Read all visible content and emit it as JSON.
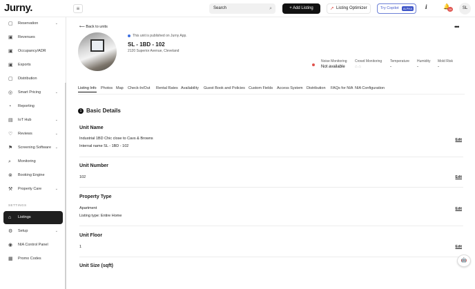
{
  "header": {
    "logo": "Jurny.",
    "collapse_icon": "≡",
    "search_placeholder": "Search",
    "add_listing": "+ Add Listing",
    "optimizer": "Listing Optimizer",
    "copilot": "Try Copilot",
    "copilot_badge": "ALPHA",
    "info": "i",
    "notif_count": "19",
    "avatar": "SL"
  },
  "sidebar": {
    "items": [
      {
        "label": "Reservation",
        "icon": "▢",
        "chev": "⌄"
      },
      {
        "label": "Revenues",
        "icon": "▣",
        "chev": ""
      },
      {
        "label": "Occupancy/ADR",
        "icon": "▣",
        "chev": ""
      },
      {
        "label": "Exports",
        "icon": "▣",
        "chev": ""
      },
      {
        "label": "Distribution",
        "icon": "▢",
        "chev": ""
      },
      {
        "label": "Smart Pricing",
        "icon": "◎",
        "chev": "⌄"
      },
      {
        "label": "Reporting",
        "icon": "◔",
        "chev": ""
      },
      {
        "label": "IoT Hub",
        "icon": "▤",
        "chev": "⌄"
      },
      {
        "label": "Reviews",
        "icon": "♡",
        "chev": "⌄"
      },
      {
        "label": "Screening Software",
        "icon": "⚑",
        "chev": "⌄"
      },
      {
        "label": "Monitoring",
        "icon": "⌕",
        "chev": ""
      },
      {
        "label": "Booking Engine",
        "icon": "⊗",
        "chev": ""
      },
      {
        "label": "Property Care",
        "icon": "⚒",
        "chev": "⌄"
      }
    ],
    "section": "SETTINGS",
    "settings": [
      {
        "label": "Listings",
        "icon": "⌂",
        "chev": ""
      },
      {
        "label": "Setup",
        "icon": "⚙",
        "chev": "⌄"
      },
      {
        "label": "NIA Control Panel",
        "icon": "◉",
        "chev": ""
      },
      {
        "label": "Promo Codes",
        "icon": "▦",
        "chev": ""
      }
    ]
  },
  "unit": {
    "back": "Back to units",
    "published": "This unit is published on Jurny App.",
    "title": "SL - 1BD - 102",
    "address": "2120 Superior Avenue, Cleveland"
  },
  "monitoring": [
    {
      "label": "Noise Monitoring",
      "value": "Not available"
    },
    {
      "label": "Crowd Monitoring",
      "value": "⌂ ⌂"
    },
    {
      "label": "Temperature",
      "value": "-"
    },
    {
      "label": "Humidity",
      "value": "-"
    },
    {
      "label": "Mold Risk",
      "value": "-"
    }
  ],
  "tabs": [
    "Listing Info",
    "Photos",
    "Map",
    "Check-In/Out",
    "Rental Rates",
    "Availability",
    "Guest Book and Policies",
    "Custom Fields",
    "Access System",
    "Distribution",
    "FAQs for NIA",
    "NIA Configuration"
  ],
  "section": {
    "number": "1",
    "title": "Basic Details"
  },
  "fields": [
    {
      "label": "Unit Name",
      "lines": [
        "Industrial 1BD Chic close to Cavs & Browns",
        "Internal name SL - 1BD - 102"
      ],
      "edit": "Edit"
    },
    {
      "label": "Unit Number",
      "lines": [
        "102"
      ],
      "edit": "Edit"
    },
    {
      "label": "Property Type",
      "lines": [
        "Apartment",
        "Listing type: Entire Home"
      ],
      "edit": "Edit"
    },
    {
      "label": "Unit Floor",
      "lines": [
        "1"
      ],
      "edit": "Edit"
    },
    {
      "label": "Unit Size (sqft)",
      "lines": [],
      "edit": ""
    }
  ],
  "fab_icon": "robot-icon"
}
